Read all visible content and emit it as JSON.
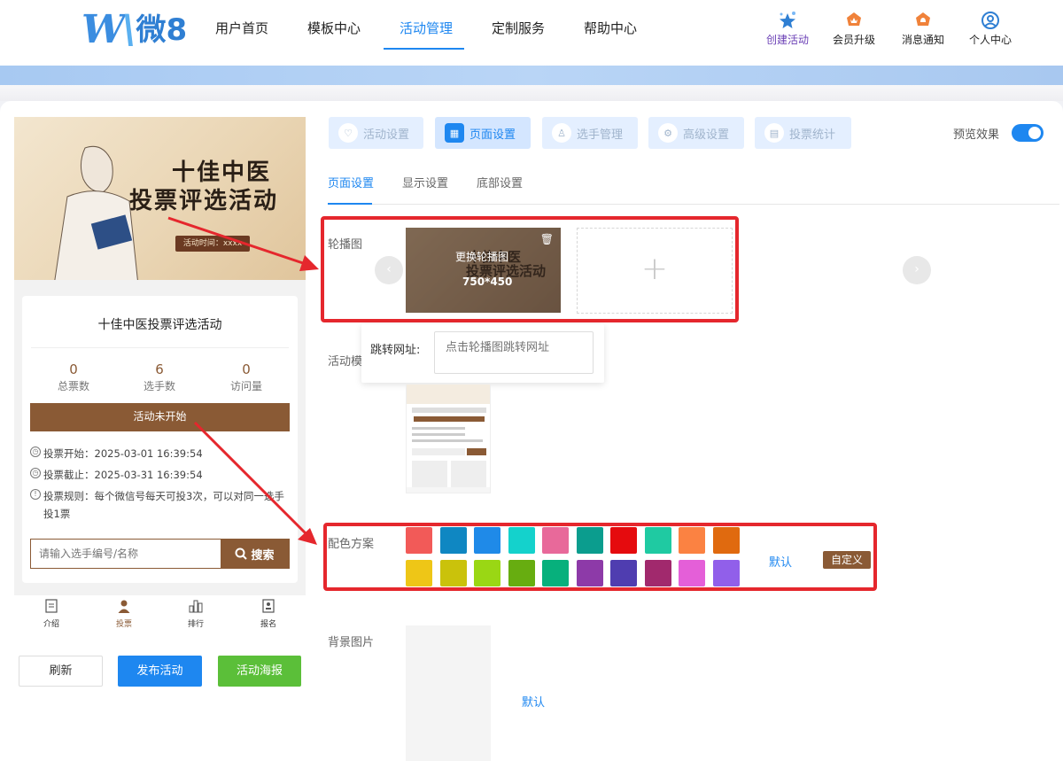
{
  "header": {
    "logo_w": "W",
    "logo_text": "微8",
    "nav": [
      {
        "label": "用户首页"
      },
      {
        "label": "模板中心"
      },
      {
        "label": "活动管理"
      },
      {
        "label": "定制服务"
      },
      {
        "label": "帮助中心"
      }
    ],
    "actions": [
      {
        "label": "创建活动",
        "icon": "stars-icon"
      },
      {
        "label": "会员升级",
        "icon": "crown-badge-icon"
      },
      {
        "label": "消息通知",
        "icon": "bell-badge-icon"
      },
      {
        "label": "个人中心",
        "icon": "user-circle-icon"
      }
    ]
  },
  "preview": {
    "banner": {
      "title_line1": "十佳中医",
      "title_line2": "投票评选活动",
      "time_label": "活动时间：xxxx"
    },
    "activity_title": "十佳中医投票评选活动",
    "stats": [
      {
        "value": "0",
        "label": "总票数"
      },
      {
        "value": "6",
        "label": "选手数"
      },
      {
        "value": "0",
        "label": "访问量"
      }
    ],
    "status_button": "活动未开始",
    "rules": [
      {
        "text": "投票开始：2025-03-01 16:39:54"
      },
      {
        "text": "投票截止：2025-03-31 16:39:54"
      },
      {
        "text": "投票规则：每个微信号每天可投3次，可以对同一选手投1票"
      }
    ],
    "search_placeholder": "请输入选手编号/名称",
    "search_button": "搜索",
    "tabbar": [
      {
        "label": "介绍"
      },
      {
        "label": "投票"
      },
      {
        "label": "排行"
      },
      {
        "label": "报名"
      }
    ]
  },
  "left_buttons": {
    "refresh": "刷新",
    "publish": "发布活动",
    "poster": "活动海报"
  },
  "settings_tabs": [
    {
      "label": "活动设置"
    },
    {
      "label": "页面设置"
    },
    {
      "label": "选手管理"
    },
    {
      "label": "高级设置"
    },
    {
      "label": "投票统计"
    }
  ],
  "preview_toggle_label": "预览效果",
  "sub_tabs": [
    {
      "label": "页面设置"
    },
    {
      "label": "显示设置"
    },
    {
      "label": "底部设置"
    }
  ],
  "carousel": {
    "label": "轮播图",
    "image_title_line1": "十佳中医",
    "image_title_line2": "投票评选活动",
    "change_text": "更换轮播图",
    "size_text": "750*450",
    "add_symbol": "+",
    "prev": "‹",
    "next": "›"
  },
  "jump_url": {
    "label": "跳转网址:",
    "placeholder": "点击轮播图跳转网址"
  },
  "template_label": "活动模",
  "color_scheme": {
    "label": "配色方案",
    "colors_row1": [
      "#f25a58",
      "#0f87c2",
      "#1f8ae8",
      "#14d2cc",
      "#e8699a",
      "#0b9d8e",
      "#e50b0e",
      "#1fcaa2",
      "#fb8242",
      "#e06a0f"
    ],
    "colors_row2": [
      "#eec617",
      "#cac20b",
      "#9ad714",
      "#67ad10",
      "#07b07c",
      "#8d3aa8",
      "#4f3db0",
      "#a1296d",
      "#e45fd8",
      "#915fea"
    ],
    "default_link": "默认",
    "custom_button": "自定义"
  },
  "background": {
    "label": "背景图片",
    "default_link": "默认"
  }
}
